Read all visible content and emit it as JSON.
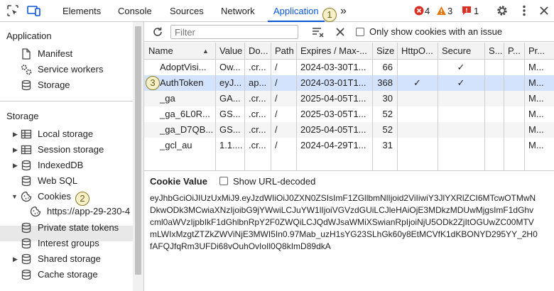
{
  "topbar": {
    "tabs": [
      {
        "label": "Elements"
      },
      {
        "label": "Console"
      },
      {
        "label": "Sources"
      },
      {
        "label": "Network"
      },
      {
        "label": "Application"
      }
    ],
    "active_tab": "Application",
    "more_label": "»",
    "errors_count": "4",
    "warnings_count": "3",
    "issues_count": "1",
    "callout_1": "1"
  },
  "sidebar": {
    "application_title": "Application",
    "application_items": [
      {
        "label": "Manifest",
        "icon": "file-icon"
      },
      {
        "label": "Service workers",
        "icon": "gears-icon"
      },
      {
        "label": "Storage",
        "icon": "database-icon"
      }
    ],
    "storage_title": "Storage",
    "storage_items": [
      {
        "label": "Local storage",
        "icon": "table-icon",
        "expandable": true
      },
      {
        "label": "Session storage",
        "icon": "table-icon",
        "expandable": true
      },
      {
        "label": "IndexedDB",
        "icon": "database-icon",
        "expandable": true
      },
      {
        "label": "Web SQL",
        "icon": "database-icon",
        "expandable": false
      },
      {
        "label": "Cookies",
        "icon": "cookie-icon",
        "expandable": true,
        "expanded": true
      },
      {
        "label": "https://app-29-230-4",
        "icon": "cookie-icon",
        "child": true,
        "selected": true
      },
      {
        "label": "Private state tokens",
        "icon": "database-icon",
        "expandable": false
      },
      {
        "label": "Interest groups",
        "icon": "database-icon",
        "expandable": false
      },
      {
        "label": "Shared storage",
        "icon": "database-icon",
        "expandable": true
      },
      {
        "label": "Cache storage",
        "icon": "database-icon",
        "expandable": false
      }
    ],
    "callout_2": "2"
  },
  "toolbar": {
    "filter_placeholder": "Filter",
    "only_issue_label": "Only show cookies with an issue"
  },
  "table": {
    "columns": [
      "Name",
      "Value",
      "Do...",
      "Path",
      "Expires / Max-...",
      "Size",
      "HttpO...",
      "Secure",
      "S...",
      "P...",
      "Pr..."
    ],
    "rows": [
      {
        "name": "AdoptVisi...",
        "value": "Ow...",
        "domain": ".cr...",
        "path": "/",
        "expires": "2024-03-30T1...",
        "size": "66",
        "httponly": "",
        "secure": "✓",
        "samesite": "",
        "partition": "",
        "priority": "M..."
      },
      {
        "name": "AuthToken",
        "value": "eyJ...",
        "domain": "ap...",
        "path": "/",
        "expires": "2024-03-01T1...",
        "size": "368",
        "httponly": "✓",
        "secure": "✓",
        "samesite": "",
        "partition": "",
        "priority": "M...",
        "selected": true
      },
      {
        "name": "_ga",
        "value": "GA...",
        "domain": ".cr...",
        "path": "/",
        "expires": "2025-04-05T1...",
        "size": "30",
        "httponly": "",
        "secure": "",
        "samesite": "",
        "partition": "",
        "priority": "M..."
      },
      {
        "name": "_ga_6L0R...",
        "value": "GS...",
        "domain": ".cr...",
        "path": "/",
        "expires": "2025-03-05T1...",
        "size": "52",
        "httponly": "",
        "secure": "",
        "samesite": "",
        "partition": "",
        "priority": "M..."
      },
      {
        "name": "_ga_D7QB...",
        "value": "GS...",
        "domain": ".cr...",
        "path": "/",
        "expires": "2025-04-05T1...",
        "size": "52",
        "httponly": "",
        "secure": "",
        "samesite": "",
        "partition": "",
        "priority": "M..."
      },
      {
        "name": "_gcl_au",
        "value": "1.1....",
        "domain": ".cr...",
        "path": "/",
        "expires": "2024-04-29T1...",
        "size": "31",
        "httponly": "",
        "secure": "",
        "samesite": "",
        "partition": "",
        "priority": "M..."
      }
    ],
    "callout_3": "3"
  },
  "cookie_value": {
    "title": "Cookie Value",
    "show_decoded_label": "Show URL-decoded",
    "lines": [
      "eyJhbGciOiJIUzUxMiJ9.eyJzdWIiOiJ0ZXN0ZSIsImF1ZGllbmNlIjoid2ViIiwiY3JlYXRlZCI6MTcwOTMwN",
      "DkwODk3MCwiaXNzIjoibG9jYWwiLCJuYW1lIjoiVGVzdGUiLCJleHAiOjE3MDkzMDUwMjgsImF1dGhv",
      "cml0aWVzIjpbIkF1dGhlbnRpY2F0ZWQiLCJQdWJsaWMiXSwianRpIjoiNjU5ODk2ZjItOGUwZC00MTV",
      "mLWIxMzgtZTZkZWViNjE3MWI5In0.97Mab_uzH1sYG23SLhGk60y8EtMCVfK1dKBONYD295YY_2H0",
      "fAFQJfqRm3UFDi68vOuhOvIoIl0Q8kImD89dkA"
    ]
  },
  "colors": {
    "accent": "#0b57d0",
    "error": "#d93025",
    "warning": "#e37400",
    "selected_row": "#d3e3fd"
  }
}
